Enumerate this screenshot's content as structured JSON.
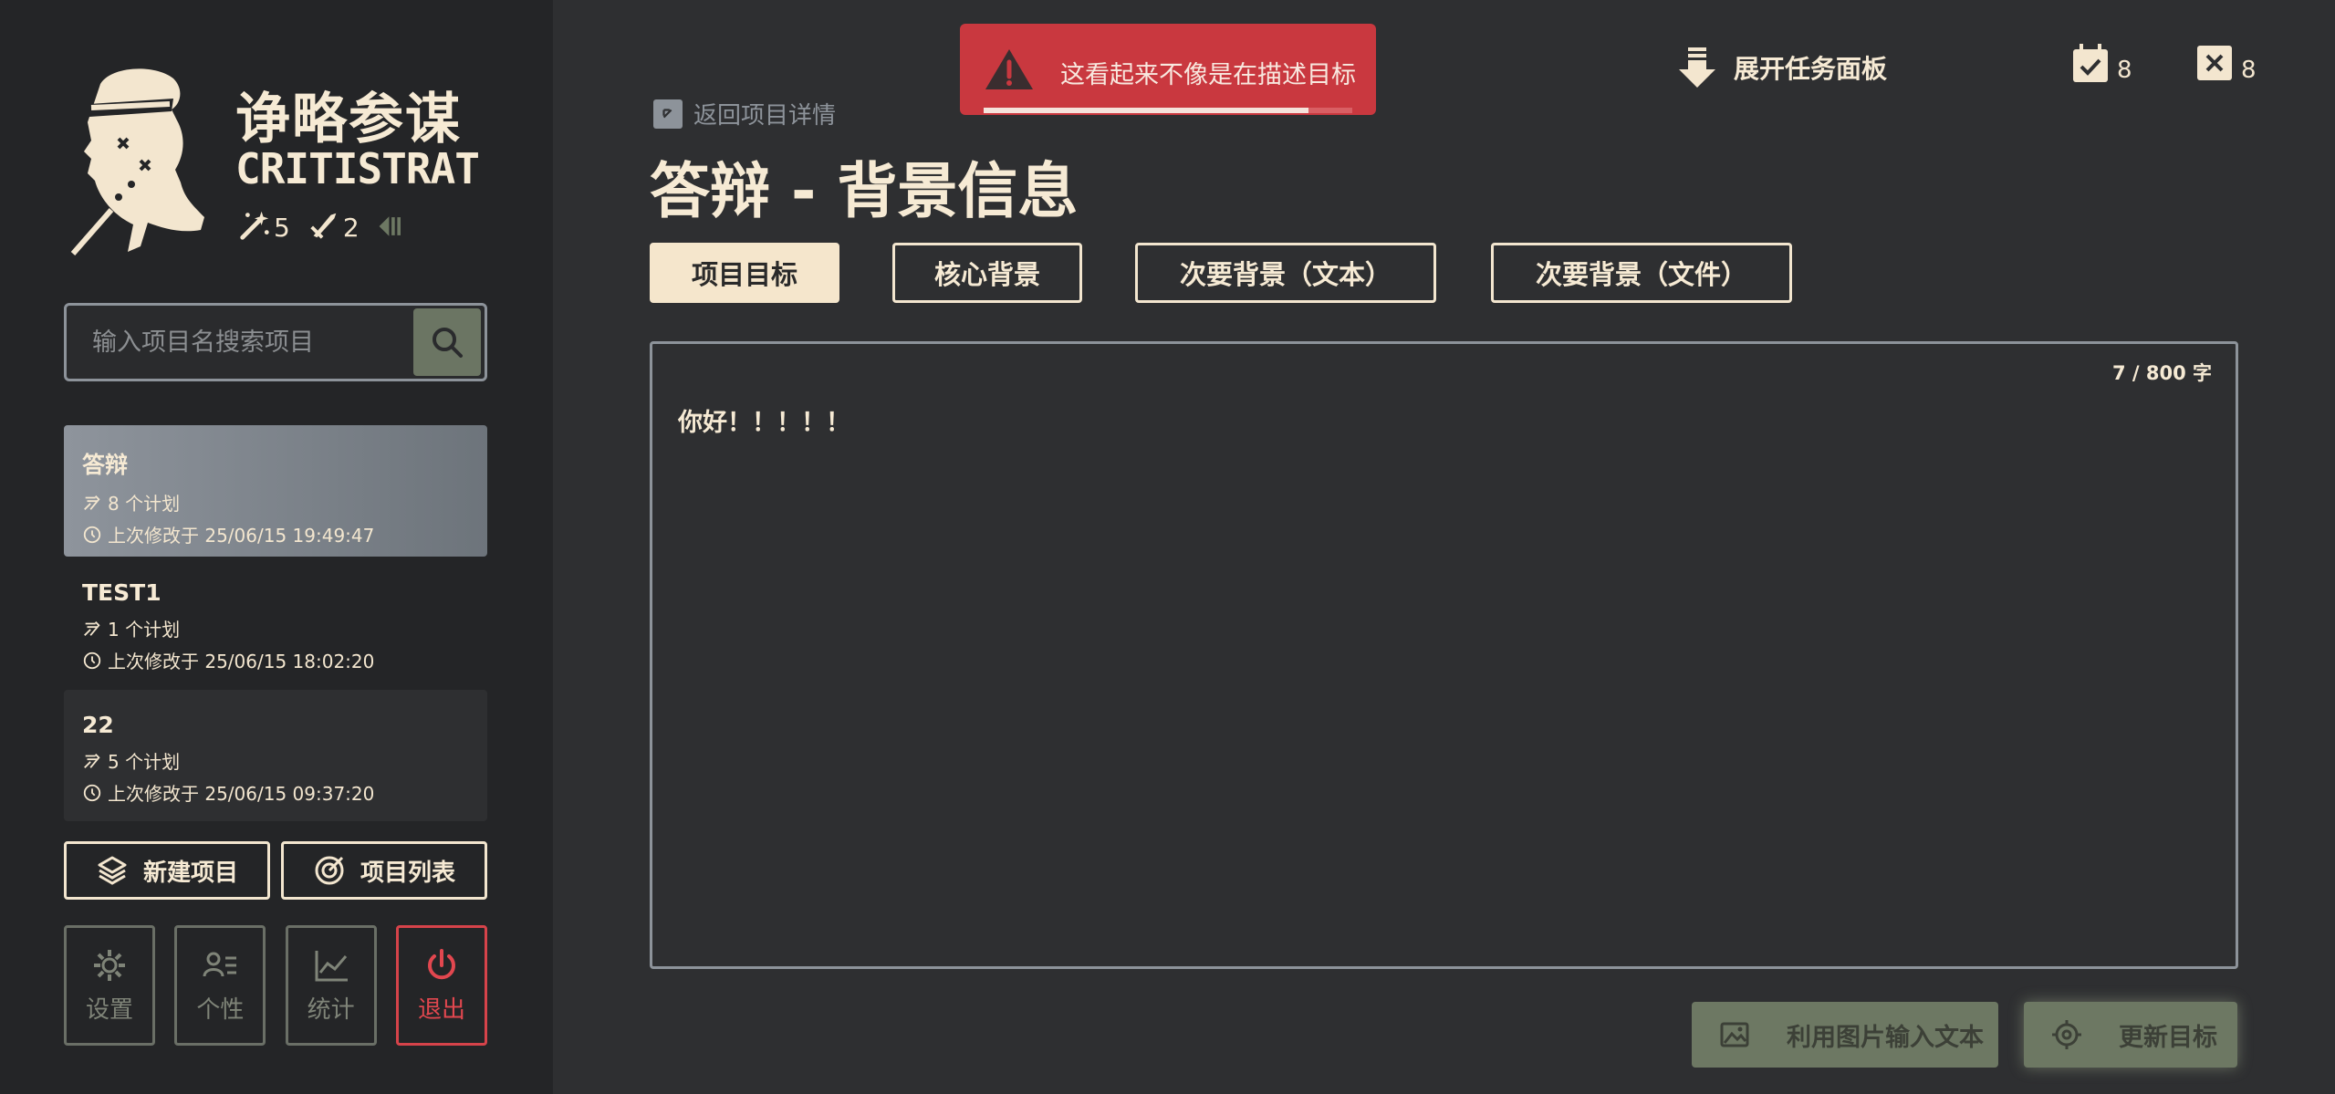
{
  "brand": {
    "name_cn": "诤略参谋",
    "name_en": "CRITISTRAT",
    "stat_a": "5",
    "stat_b": "2"
  },
  "search": {
    "placeholder": "输入项目名搜索项目"
  },
  "projects": [
    {
      "name": "答辩",
      "plans": "8 个计划",
      "modified": "上次修改于 25/06/15 19:49:47"
    },
    {
      "name": "TEST1",
      "plans": "1 个计划",
      "modified": "上次修改于 25/06/15 18:02:20"
    },
    {
      "name": "22",
      "plans": "5 个计划",
      "modified": "上次修改于 25/06/15 09:37:20"
    }
  ],
  "actions": {
    "new_project": "新建项目",
    "project_list": "项目列表"
  },
  "tools": {
    "settings": "设置",
    "personal": "个性",
    "stats": "统计",
    "logout": "退出"
  },
  "toast": {
    "message": "这看起来不像是在描述目标",
    "progress": 0.88
  },
  "header": {
    "expand_label": "展开任务面板",
    "done_count": "8",
    "failed_count": "8"
  },
  "back": {
    "label": "返回项目详情"
  },
  "page": {
    "title": "答辩 - 背景信息"
  },
  "tabs": [
    {
      "label": "项目目标",
      "active": true
    },
    {
      "label": "核心背景",
      "active": false
    },
    {
      "label": "次要背景（文本）",
      "active": false
    },
    {
      "label": "次要背景（文件）",
      "active": false
    }
  ],
  "editor": {
    "count": "7 / 800 字",
    "content": "你好！！！！！"
  },
  "buttons": {
    "image_input": "利用图片输入文本",
    "update_goal": "更新目标"
  },
  "colors": {
    "accent_cream": "#f5e6cc",
    "danger": "#c9383f",
    "muted_green": "#6d7863"
  }
}
